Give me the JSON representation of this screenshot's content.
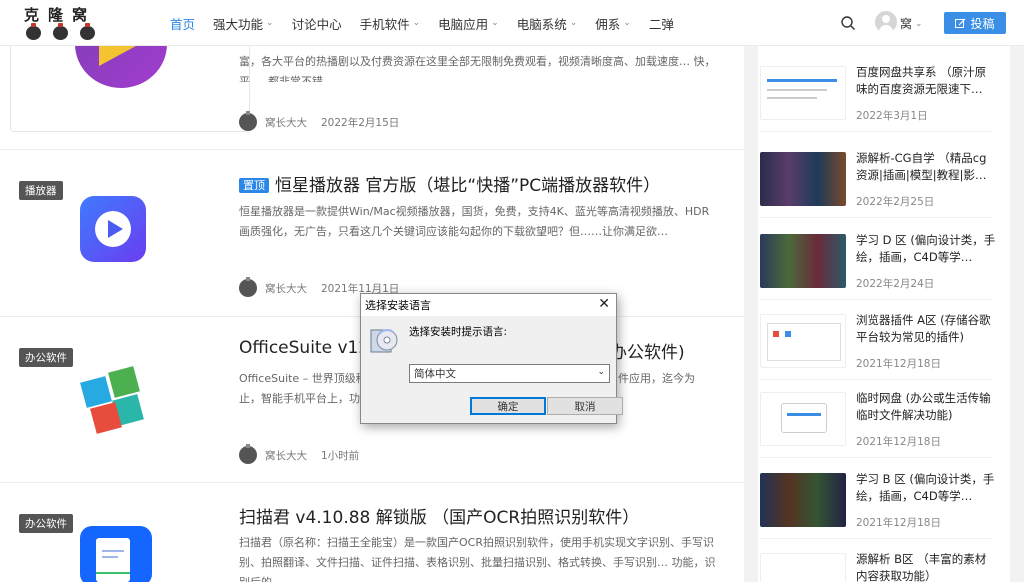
{
  "site": {
    "logo_text": "克隆窝",
    "nav": [
      {
        "label": "首页",
        "dropdown": false,
        "active": true
      },
      {
        "label": "强大功能",
        "dropdown": true
      },
      {
        "label": "讨论中心",
        "dropdown": false
      },
      {
        "label": "手机软件",
        "dropdown": true
      },
      {
        "label": "电脑应用",
        "dropdown": true
      },
      {
        "label": "电脑系统",
        "dropdown": true
      },
      {
        "label": "佣系",
        "dropdown": true
      },
      {
        "label": "二弹",
        "dropdown": false
      }
    ],
    "user_name": "窝",
    "post_button": "投稿",
    "accent": "#2b87e8"
  },
  "posts": [
    {
      "tag": "",
      "title": "",
      "excerpt": "富，各大平台的热播剧以及付费资源在这里全部无限制免费观看，视频清晰度高、加载速度… 快，平 … 都非常不错",
      "author": "窝长大大",
      "date": "2022年2月15日"
    },
    {
      "tag": "播放器",
      "badge": "置顶",
      "title": "恒星播放器 官方版（堪比“快播”PC端播放器软件）",
      "excerpt": "恒星播放器是一款提供Win/Mac视频播放器，国货，免费，支持4K、蓝光等高清视频播放、HDR 画质强化，无广告，只看这几个关键词应该能勾起你的下载欲望吧？但……让你满足欲…",
      "author": "窝长大大",
      "date": "2021年11月1日"
    },
    {
      "tag": "办公软件",
      "title_left": "OfficeSuite v12.",
      "title_right": "办公软件)",
      "excerpt_left": "OfficeSuite – 世界顶级移",
      "excerpt_right": "件应用，迄今为",
      "excerpt_line2": "止，智能手机平台上，功",
      "author": "窝长大大",
      "date": "1小时前"
    },
    {
      "tag": "办公软件",
      "title": "扫描君 v4.10.88 解锁版 （国产OCR拍照识别软件）",
      "excerpt": "扫描君（原名称：扫描王全能宝）是一款国产OCR拍照识别软件，使用手机实现文字识别、手写识别、拍照翻译、文件扫描、证件扫描、表格识别、批量扫描识别、格式转换、手写识别… 功能，识别后的",
      "author": "",
      "date": ""
    }
  ],
  "sidebar": [
    {
      "title": "百度网盘共享系 （原汁原味的百度资源无限速下…",
      "date": "2022年3月1日"
    },
    {
      "title": "源解析-CG自学 （精品cg资源|插画|模型|教程|影…",
      "date": "2022年2月25日"
    },
    {
      "title": "学习 D 区 (偏向设计类，手绘，插画，C4D等学…",
      "date": "2022年2月24日"
    },
    {
      "title": "浏览器插件 A区 (存储谷歌平台较为常见的插件)",
      "date": "2021年12月18日"
    },
    {
      "title": "临时网盘 (办公或生活传输临时文件解决功能)",
      "date": "2021年12月18日"
    },
    {
      "title": "学习 B 区 (偏向设计类，手绘，插画，C4D等学…",
      "date": "2021年12月18日"
    },
    {
      "title": "源解析 B区 （丰富的素材内容获取功能）",
      "date": ""
    }
  ],
  "dialog": {
    "title": "选择安装语言",
    "prompt": "选择安装时提示语言:",
    "selected_language": "简体中文",
    "ok": "确定",
    "cancel": "取消"
  }
}
